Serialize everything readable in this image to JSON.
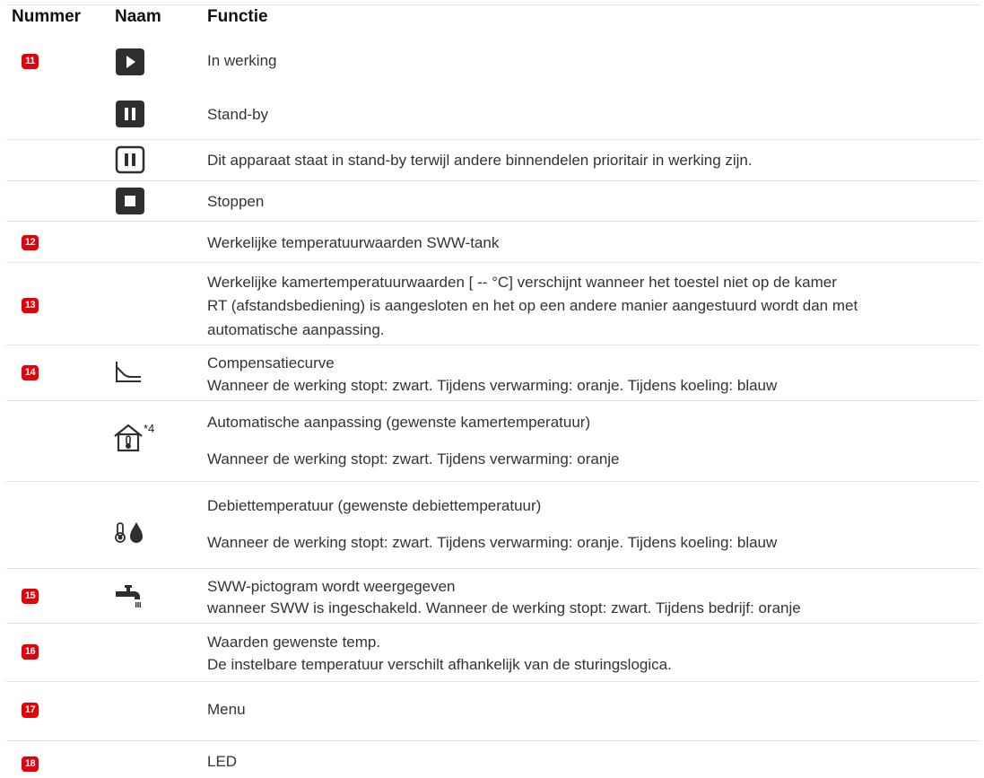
{
  "table": {
    "headers": {
      "number": "Nummer",
      "name": "Naam",
      "function": "Functie"
    },
    "rows": {
      "r11": {
        "number": "11",
        "items": [
          "In werking",
          "Stand-by"
        ]
      },
      "r11b": {
        "text": "Dit apparaat staat in stand-by terwijl andere binnendelen prioritair in werking zijn."
      },
      "r11c": {
        "text": "Stoppen"
      },
      "r12": {
        "number": "12",
        "text": "Werkelijke temperatuurwaarden SWW-tank"
      },
      "r13": {
        "number": "13",
        "lines": [
          "Werkelijke kamertemperatuurwaarden [ -- °C] verschijnt wanneer het toestel niet op de kamer",
          "RT (afstandsbediening) is aangesloten en het op een andere manier aangestuurd wordt dan met",
          "automatische aanpassing."
        ]
      },
      "r14": {
        "number": "14",
        "lines": [
          "Compensatiecurve",
          "Wanneer de werking stopt: zwart. Tijdens verwarming: oranje. Tijdens koeling: blauw"
        ]
      },
      "r14b": {
        "superscript": "*4",
        "lines": [
          "Automatische aanpassing (gewenste kamertemperatuur)",
          "Wanneer de werking stopt: zwart. Tijdens verwarming: oranje"
        ]
      },
      "r14c": {
        "lines": [
          "Debiettemperatuur (gewenste debiettemperatuur)",
          "Wanneer de werking stopt: zwart. Tijdens verwarming: oranje. Tijdens koeling: blauw"
        ]
      },
      "r15": {
        "number": "15",
        "lines": [
          "SWW-pictogram wordt weergegeven",
          "wanneer SWW is ingeschakeld. Wanneer de werking stopt: zwart. Tijdens bedrijf: oranje"
        ]
      },
      "r16": {
        "number": "16",
        "lines": [
          "Waarden gewenste temp.",
          "De instelbare temperatuur verschilt afhankelijk van de sturingslogica."
        ]
      },
      "r17": {
        "number": "17",
        "text": "Menu"
      },
      "r18": {
        "number": "18",
        "text": "LED"
      }
    }
  },
  "icons": {
    "r11": [
      "play-icon",
      "pause-icon"
    ],
    "r11b": "pause-outline-icon",
    "r11c": "stop-icon",
    "r14": "compensation-curve-icon",
    "r14b": "house-thermometer-icon",
    "r14c": "thermometer-drop-icon",
    "r15": "faucet-icon"
  },
  "colors": {
    "badge": "#e3000b",
    "icon": "#2f2f2f",
    "divider": "#e3e3e3"
  }
}
